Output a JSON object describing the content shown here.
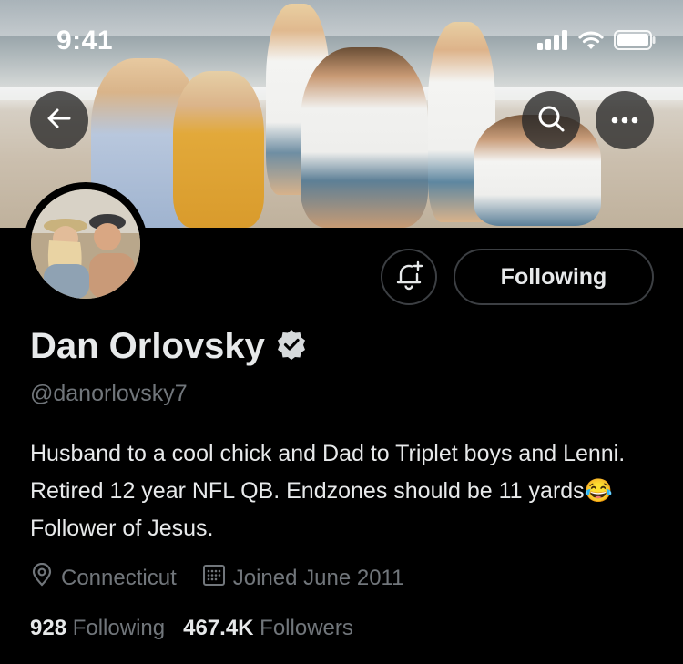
{
  "status_bar": {
    "time": "9:41"
  },
  "profile": {
    "name": "Dan Orlovsky",
    "handle": "@danorlovsky7",
    "bio": "Husband to a cool chick and Dad to Triplet boys and Lenni. Retired 12 year NFL QB. Endzones should be 11 yards😂Follower of Jesus.",
    "location": "Connecticut",
    "joined": "Joined June 2011",
    "following_count": "928",
    "following_label": "Following",
    "followers_count": "467.4K",
    "followers_label": "Followers"
  },
  "actions": {
    "follow_label": "Following"
  },
  "icons": {
    "back": "back-arrow-icon",
    "search": "search-icon",
    "more": "more-icon",
    "bell": "notification-bell-icon",
    "verified": "verified-badge-icon",
    "location": "location-pin-icon",
    "calendar": "calendar-icon"
  },
  "colors": {
    "background": "#000000",
    "text": "#e7e9ea",
    "secondary_text": "#71767b",
    "border": "#3c3f43"
  }
}
